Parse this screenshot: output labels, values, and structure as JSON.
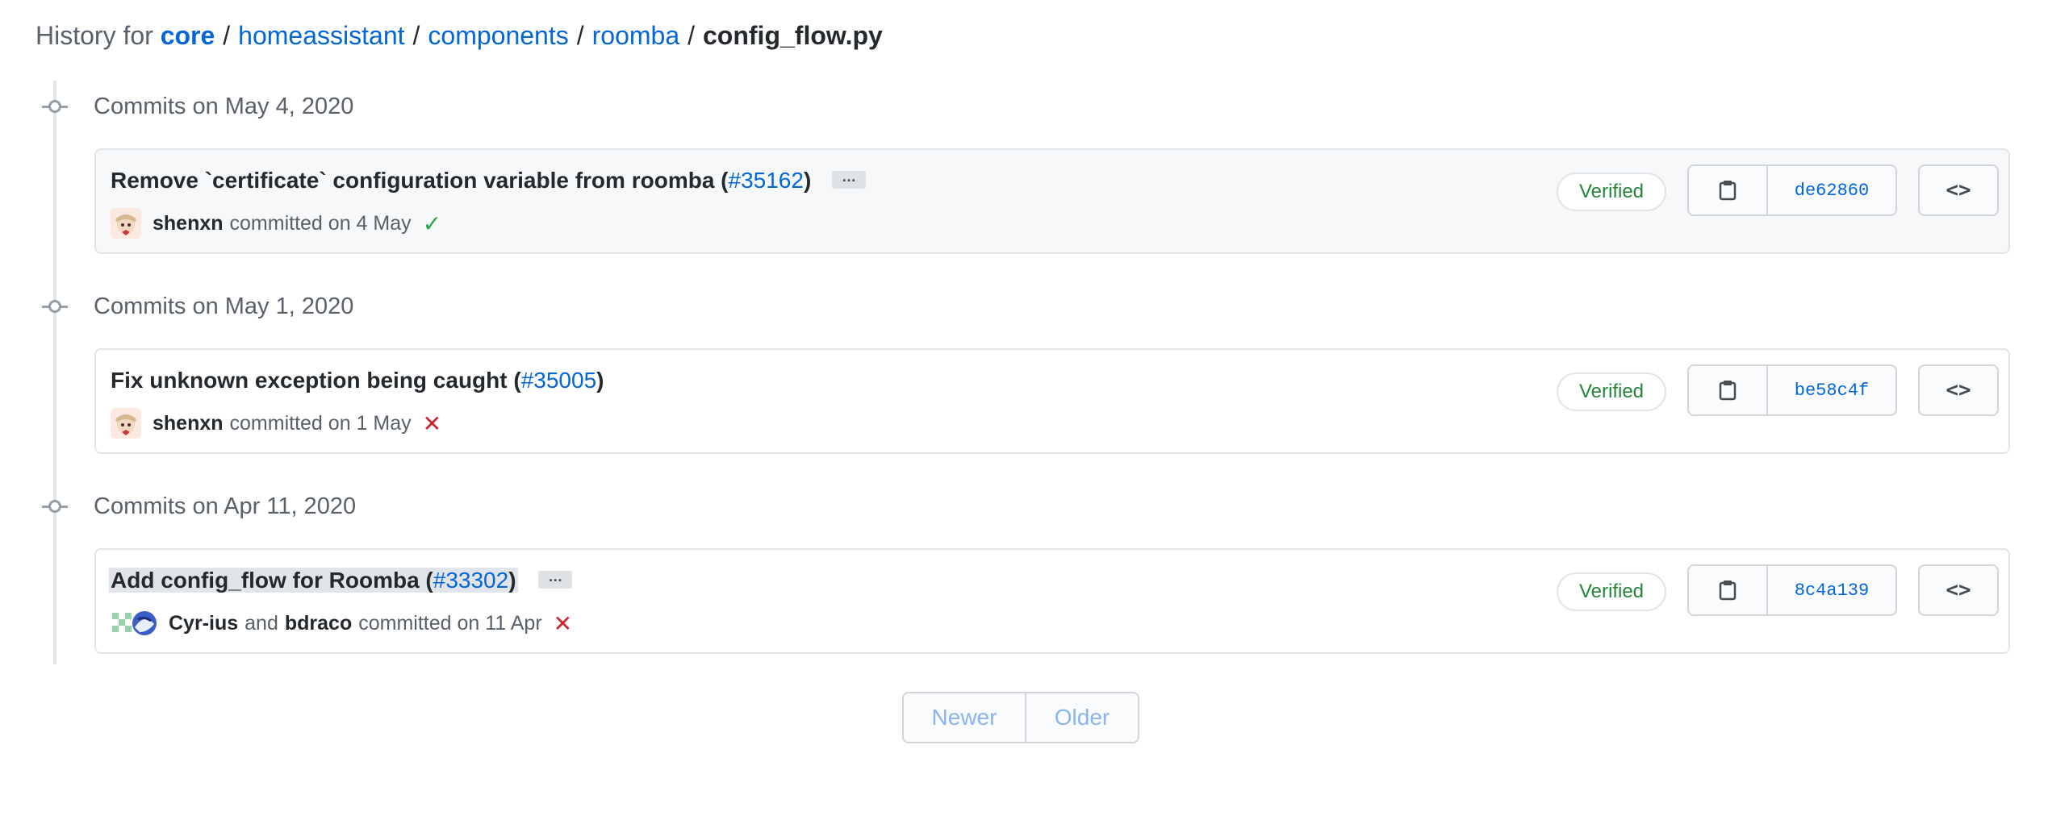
{
  "breadcrumb": {
    "prefix": "History for",
    "repo": "core",
    "separator": "/",
    "path": [
      "homeassistant",
      "components",
      "roomba"
    ],
    "file": "config_flow.py"
  },
  "groups": [
    {
      "date_label": "Commits on May 4, 2020",
      "commit": {
        "title": "Remove `certificate` configuration variable from roomba (",
        "pr": "#35162",
        "title_close": ")",
        "has_ellipsis": true,
        "ellipsis": "…",
        "author": "shenxn",
        "coauthor_join": "",
        "coauthor": "",
        "committed_text": "committed on 4 May",
        "status": "success",
        "status_icon": "check-icon",
        "status_glyph": "✓",
        "verified": "Verified",
        "sha": "de62860"
      }
    },
    {
      "date_label": "Commits on May 1, 2020",
      "commit": {
        "title": "Fix unknown exception being caught (",
        "pr": "#35005",
        "title_close": ")",
        "has_ellipsis": false,
        "ellipsis": "",
        "author": "shenxn",
        "coauthor_join": "",
        "coauthor": "",
        "committed_text": "committed on 1 May",
        "status": "failure",
        "status_icon": "x-icon",
        "status_glyph": "✕",
        "verified": "Verified",
        "sha": "be58c4f"
      }
    },
    {
      "date_label": "Commits on Apr 11, 2020",
      "commit": {
        "title": "Add config_flow for Roomba (",
        "pr": "#33302",
        "title_close": ")",
        "has_ellipsis": true,
        "ellipsis": "…",
        "author": "Cyr-ius",
        "coauthor_join": "and",
        "coauthor": "bdraco",
        "committed_text": "committed on 11 Apr",
        "status": "failure",
        "status_icon": "x-icon",
        "status_glyph": "✕",
        "verified": "Verified",
        "sha": "8c4a139"
      }
    }
  ],
  "browse_glyph": "<>",
  "pagination": {
    "newer": "Newer",
    "older": "Older"
  },
  "colors": {
    "link": "#0366d6",
    "success": "#28a745",
    "failure": "#cb2431",
    "verified": "#22863a"
  }
}
